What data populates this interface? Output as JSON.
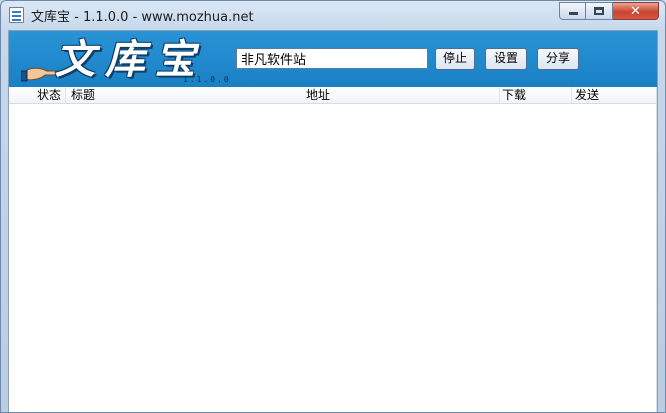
{
  "window": {
    "title": "文库宝 - 1.1.0.0 - www.mozhua.net",
    "close_glyph": "✕"
  },
  "logo": {
    "text": "文库宝",
    "version": "1.1.0.0"
  },
  "search": {
    "value": "非凡软件站"
  },
  "toolbar": {
    "stop_label": "停止",
    "settings_label": "设置",
    "share_label": "分享"
  },
  "list": {
    "columns": [
      "状态",
      "标题",
      "地址",
      "下载",
      "发送"
    ],
    "rows": []
  },
  "colors": {
    "header_band": "#1f8ad0",
    "title_bar": "#c6d8ec",
    "close_button": "#c9452d"
  }
}
